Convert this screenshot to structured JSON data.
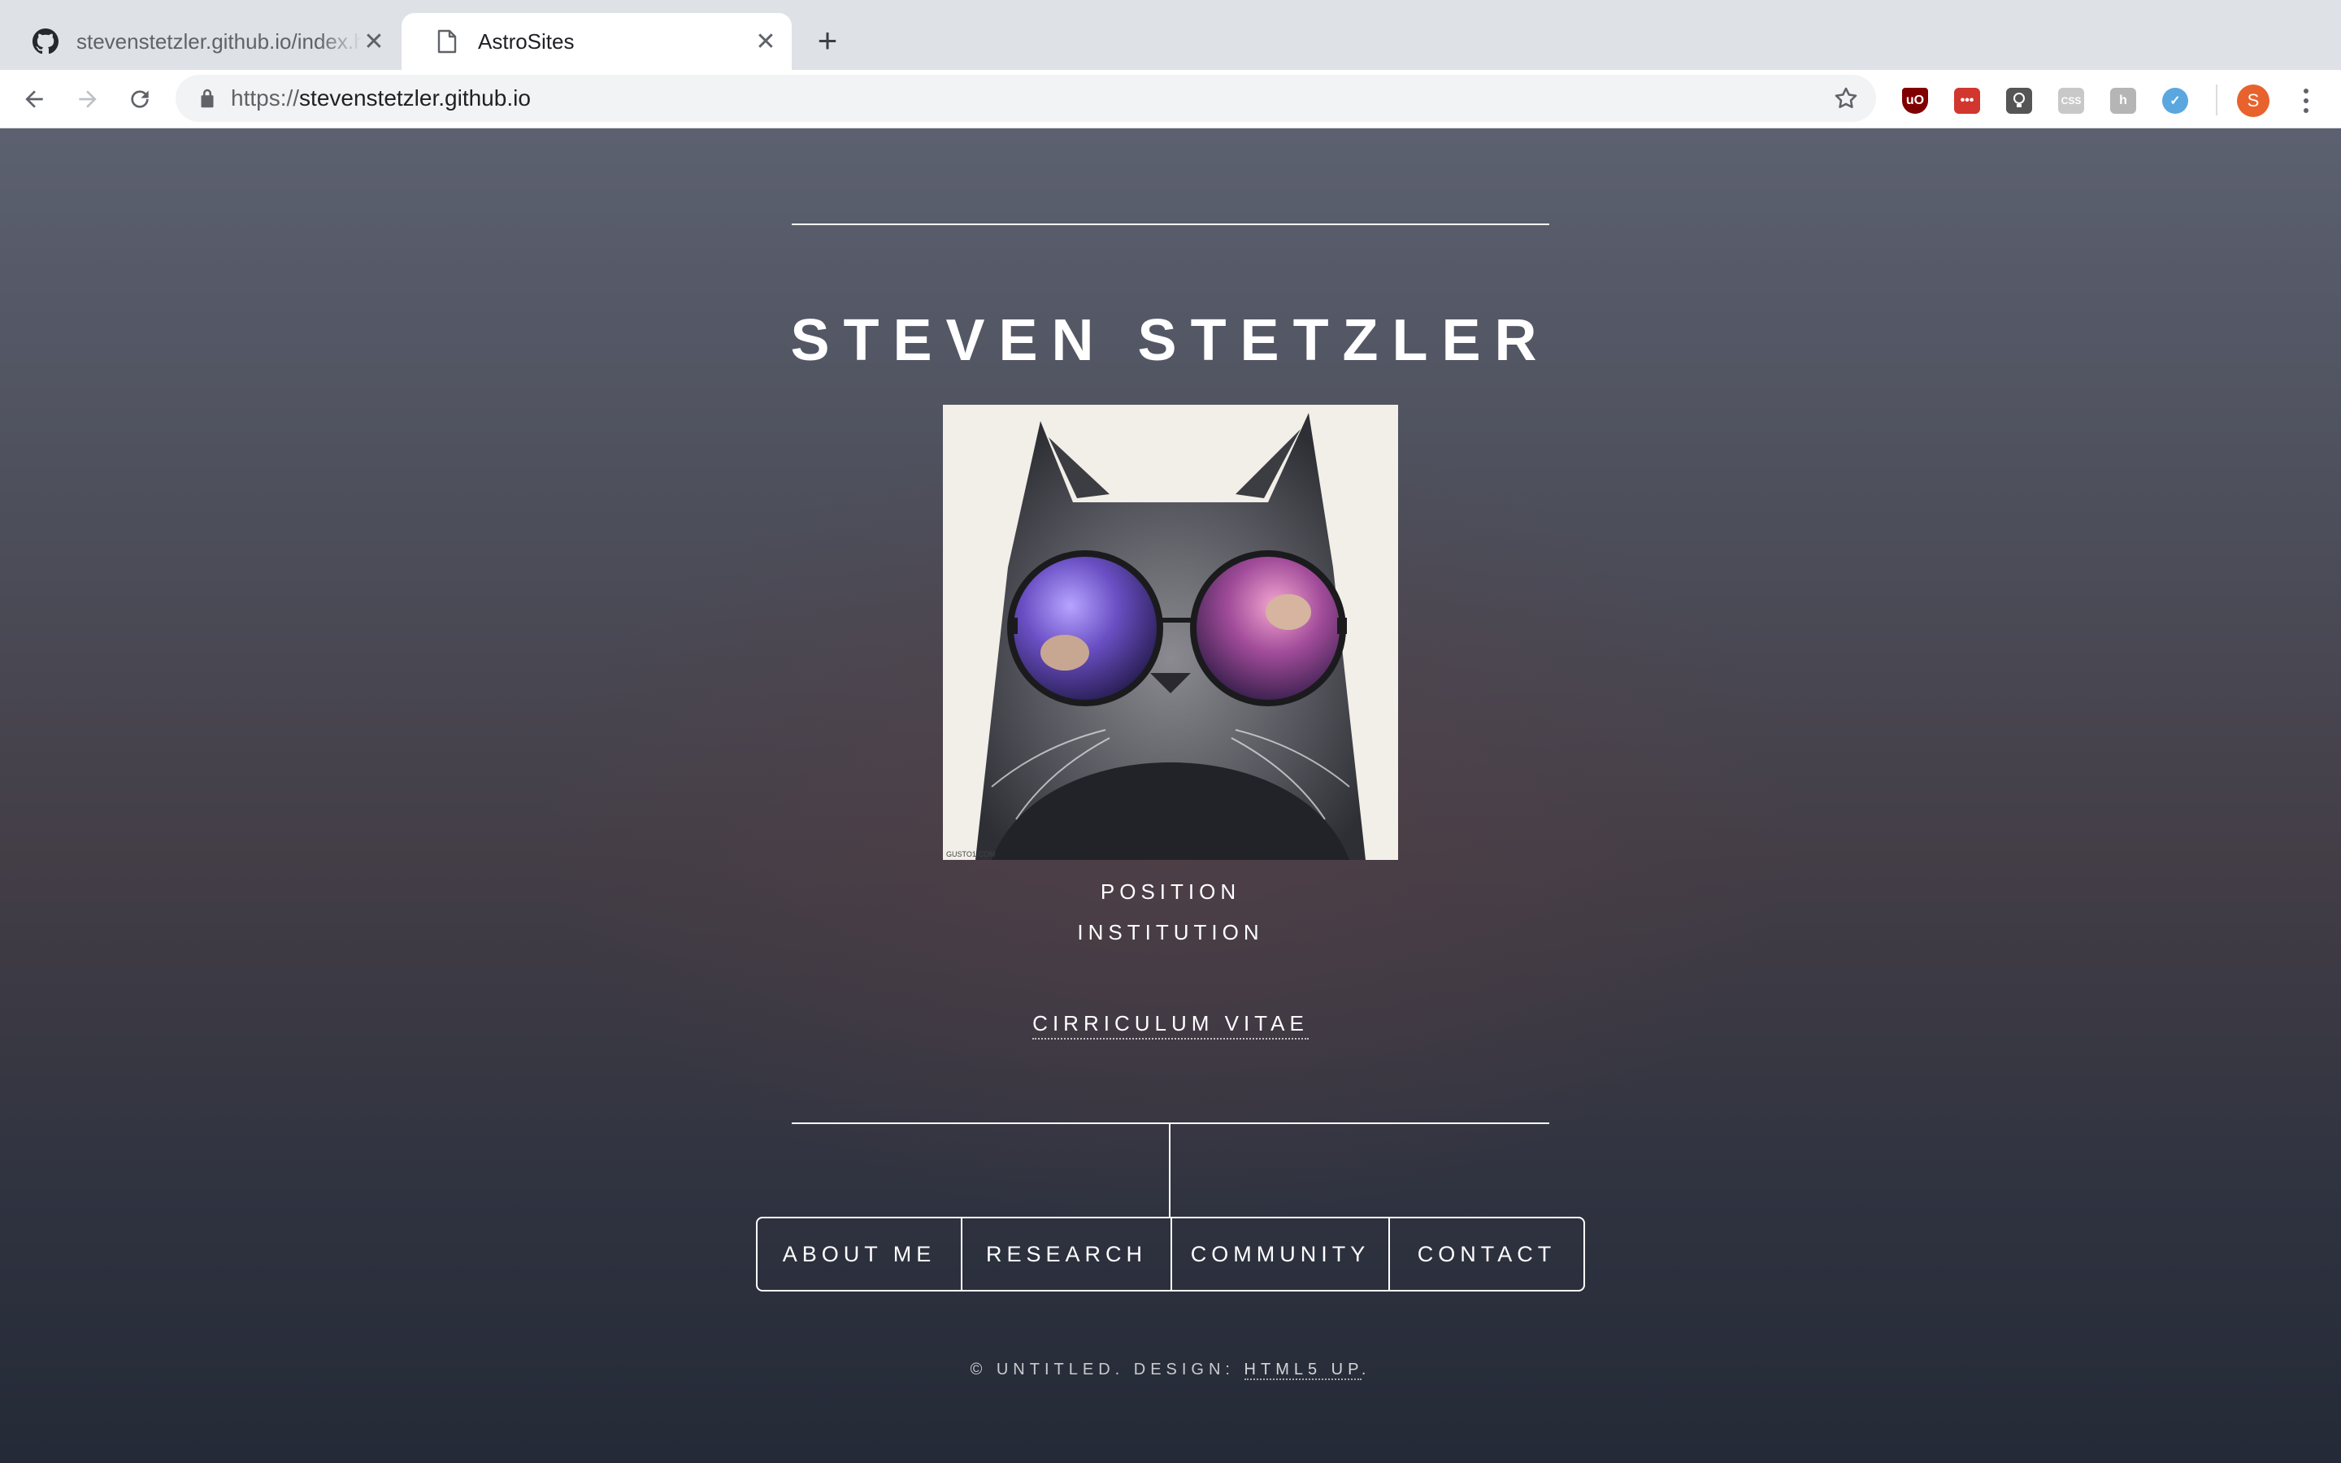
{
  "browser": {
    "tabs": [
      {
        "title": "stevenstetzler.github.io/index.html",
        "icon": "github-icon"
      },
      {
        "title": "AstroSites",
        "icon": "document-icon"
      }
    ],
    "url_scheme": "https://",
    "url_host": "stevenstetzler.github.io",
    "profile_initial": "S"
  },
  "page": {
    "name": "STEVEN STETZLER",
    "photo_caption": "GUSTO1.COM",
    "position": "POSITION",
    "institution": "INSTITUTION",
    "cv_link": "CIRRICULUM VITAE",
    "nav": [
      {
        "label": "ABOUT ME"
      },
      {
        "label": "RESEARCH"
      },
      {
        "label": "COMMUNITY"
      },
      {
        "label": "CONTACT"
      }
    ],
    "footer_prefix": "© UNTITLED. DESIGN: ",
    "footer_link": "HTML5 UP",
    "footer_suffix": "."
  },
  "colors": {
    "accent_profile": "#e8622d",
    "text": "#ffffff"
  }
}
